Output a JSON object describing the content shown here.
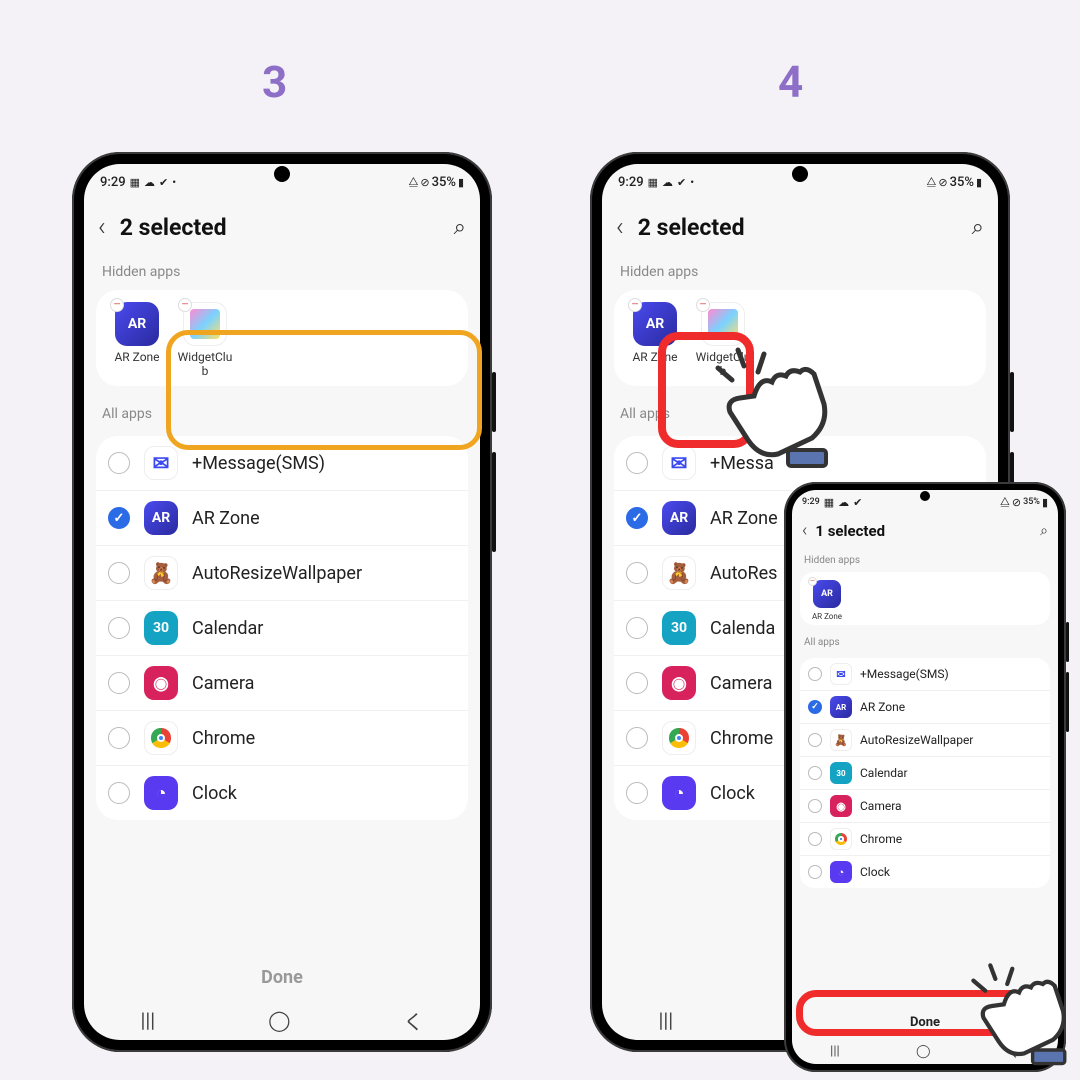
{
  "steps": {
    "left": "3",
    "right": "4"
  },
  "status": {
    "time": "9:29",
    "battery": "35%"
  },
  "header": {
    "title_2": "2 selected",
    "title_1": "1 selected"
  },
  "sections": {
    "hidden": "Hidden apps",
    "all": "All apps"
  },
  "hidden_apps": {
    "ar": "AR Zone",
    "widget": "WidgetClub",
    "widget_trunc": "WidgetClu"
  },
  "apps": [
    {
      "key": "msg",
      "name": "+Message(SMS)",
      "checked": false
    },
    {
      "key": "ar",
      "name": "AR Zone",
      "checked": true
    },
    {
      "key": "auto",
      "name": "AutoResizeWallpaper",
      "checked": false
    },
    {
      "key": "cal",
      "name": "Calendar",
      "checked": false
    },
    {
      "key": "cam",
      "name": "Camera",
      "checked": false
    },
    {
      "key": "chrome",
      "name": "Chrome",
      "checked": false
    },
    {
      "key": "clock",
      "name": "Clock",
      "checked": false
    }
  ],
  "apps_mid_trunc": {
    "msg": "+Messa",
    "auto": "AutoRes",
    "cal": "Calenda",
    "chrome": "Chrome",
    "clock": "Clock"
  },
  "done": "Done",
  "colors": {
    "step": "#8d6fc7",
    "orange_hl": "#f0a520",
    "red_hl": "#ef2b2b"
  }
}
